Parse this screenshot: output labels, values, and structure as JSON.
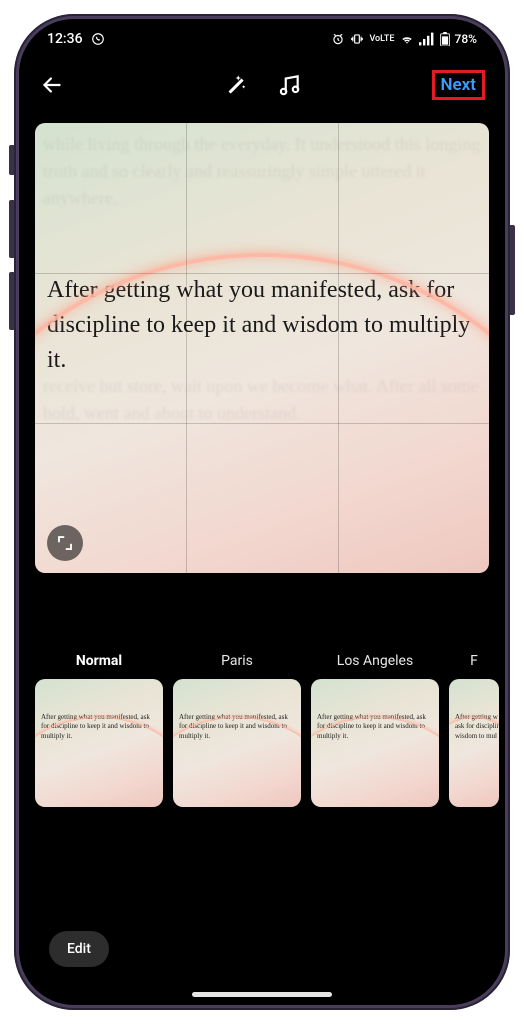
{
  "status": {
    "time": "12:36",
    "battery": "78%",
    "net": "VoLTE"
  },
  "toolbar": {
    "next_label": "Next"
  },
  "preview": {
    "quote": "After getting what you manifested, ask for discipline to keep it and wisdom to multiply it."
  },
  "filters": [
    {
      "label": "Normal",
      "active": true
    },
    {
      "label": "Paris",
      "active": false
    },
    {
      "label": "Los Angeles",
      "active": false
    },
    {
      "label": "F",
      "active": false
    }
  ],
  "thumb_quote": "After getting what you manifested, ask for discipline to keep it and wisdom to multiply it.",
  "thumb_quote_partial": "After getting w\nask for disciplin\nwisdom to mul",
  "edit_label": "Edit"
}
